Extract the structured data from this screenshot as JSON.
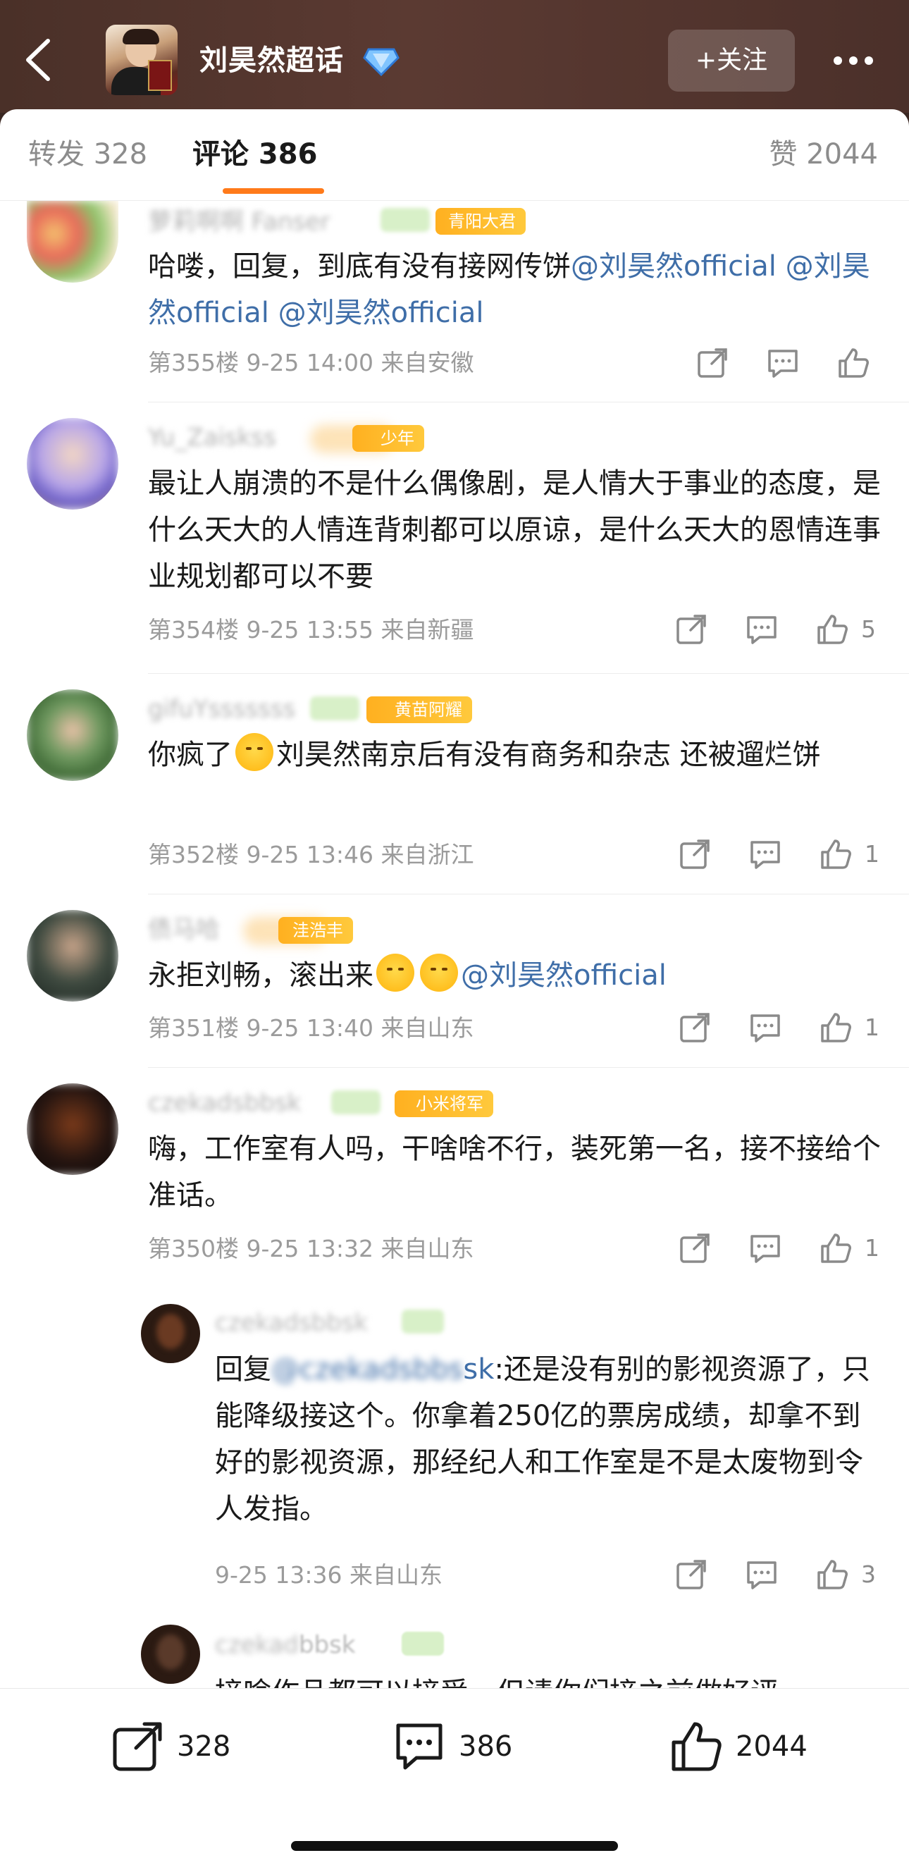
{
  "header": {
    "title": "刘昊然超话",
    "follow_label": "+关注"
  },
  "tabs": {
    "repost": "转发 328",
    "comment": "评论 386",
    "like": "赞 2044"
  },
  "comments": [
    {
      "badge": "青阳大君",
      "text_plain": "哈喽，回复，到底有没有接网传饼",
      "mentions": [
        "@刘昊然official",
        "@刘昊然official",
        "@刘昊然official"
      ],
      "meta": "第355楼 9-25 14:00 来自安徽",
      "likes": ""
    },
    {
      "badge": "少年",
      "text": "最让人崩溃的不是什么偶像剧，是人情大于事业的态度，是什么天大的人情连背刺都可以原谅，是什么天大的恩情连事业规划都可以不要",
      "meta": "第354楼 9-25 13:55 来自新疆",
      "likes": "5"
    },
    {
      "badge": "黄苗阿耀",
      "text_a": "你疯了",
      "text_b": "刘昊然南京后有没有商务和杂志 还被遛烂饼",
      "meta": "第352楼 9-25 13:46 来自浙江",
      "likes": "1"
    },
    {
      "badge": "洼浩丰",
      "text_a": "永拒刘畅，滚出来",
      "mention": "@刘昊然official",
      "meta": "第351楼 9-25 13:40 来自山东",
      "likes": "1"
    },
    {
      "badge": "小米将军",
      "text": "嗨，工作室有人吗，干啥啥不行，装死第一名，接不接给个准话。",
      "meta": "第350楼 9-25 13:32 来自山东",
      "likes": "1"
    }
  ],
  "replies": [
    {
      "prefix": "回复",
      "mention_tail": "sk",
      "text": ":还是没有别的影视资源了，只能降级接这个。你拿着250亿的票房成绩，却拿不到好的影视资源，那经纪人和工作室是不是太废物到令人发指。",
      "meta": "9-25 13:36 来自山东",
      "likes": "3"
    },
    {
      "name_tail": "bbsk",
      "text": "接啥作品都可以接受，但请你们接之前做好评"
    }
  ],
  "bottom": {
    "repost": "328",
    "comment": "386",
    "like": "2044"
  },
  "icons": {
    "back": "chevron-left-icon",
    "super-topic": "diamond-icon",
    "more": "more-icon",
    "share": "share-icon",
    "comment": "comment-icon",
    "like": "thumb-up-icon"
  },
  "colors": {
    "accent": "#ff7a1a",
    "mention": "#3f6ea8",
    "badge": "#ffb020"
  }
}
